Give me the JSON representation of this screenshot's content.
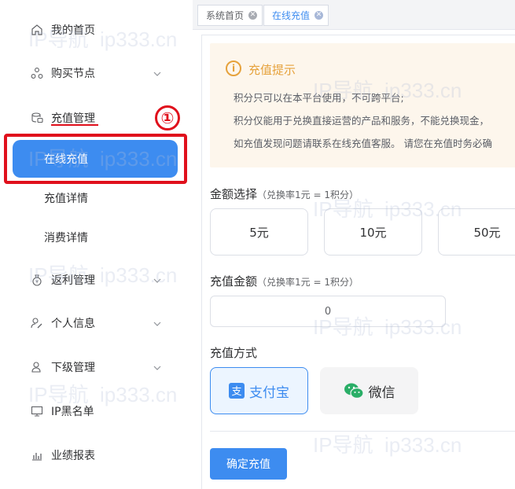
{
  "sidebar": {
    "items": [
      {
        "label": "我的首页",
        "icon": "home-icon"
      },
      {
        "label": "购买节点",
        "icon": "nodes-icon"
      },
      {
        "label": "充值管理",
        "icon": "recharge-icon"
      },
      {
        "label": "返利管理",
        "icon": "rebate-icon"
      },
      {
        "label": "个人信息",
        "icon": "user-edit-icon"
      },
      {
        "label": "下级管理",
        "icon": "user-icon"
      },
      {
        "label": "IP黑名单",
        "icon": "monitor-icon"
      },
      {
        "label": "业绩报表",
        "icon": "bar-chart-icon"
      }
    ],
    "submenu": {
      "active": "在线充值",
      "detail": "充值详情",
      "consume": "消费详情"
    },
    "annotation_number": "①"
  },
  "tabs": [
    {
      "label": "系统首页"
    },
    {
      "label": "在线充值"
    }
  ],
  "notice": {
    "title": "充值提示",
    "lines": [
      "积分只可以在本平台使用，不可跨平台;",
      "积分仅能用于兑换直接运营的产品和服务，不能兑换现金，",
      "如充值发现问题请联系在线充值客服。 请您在充值时务必确"
    ]
  },
  "amount_select": {
    "title": "金额选择",
    "hint": "（兑换率1元 = 1积分）",
    "options": [
      "5元",
      "10元",
      "50元"
    ]
  },
  "amount_input": {
    "title": "充值金额",
    "hint": "（兑换率1元 = 1积分）",
    "value": "0"
  },
  "pay_method": {
    "title": "充值方式",
    "alipay": "支付宝",
    "wechat": "微信"
  },
  "confirm_label": "确定充值",
  "watermark": [
    "IP导航",
    "ip333.cn"
  ],
  "colors": {
    "primary": "#3d8cf0",
    "warning": "#e6a23c",
    "annotation": "#e0101c"
  }
}
